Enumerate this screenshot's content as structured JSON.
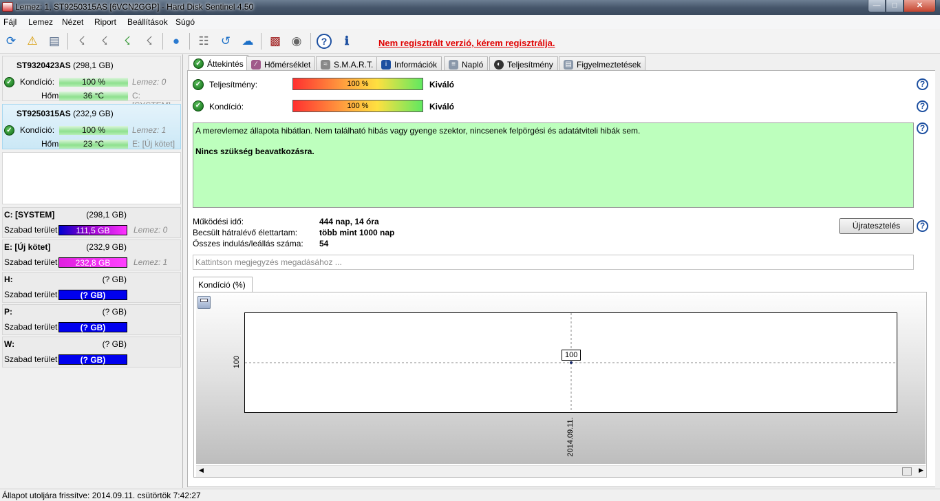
{
  "window": {
    "title": "Lemez: 1, ST9250315AS [6VCN2GGP]  -  Hard Disk Sentinel 4.50"
  },
  "menu": [
    "Fájl",
    "Lemez",
    "Nézet",
    "Riport",
    "Beállítások",
    "Súgó"
  ],
  "toolbar": {
    "icons": [
      "refresh-icon",
      "alert-icon",
      "disk-icon",
      "usb-icon-1",
      "usb-icon-2",
      "usb-icon-3",
      "usb-icon-4",
      "globe-icon",
      "report-icon",
      "sync-icon",
      "network-icon",
      "chart-icon",
      "sound-icon",
      "help-icon",
      "info-icon"
    ],
    "notice": "Nem regisztrált verzió, kérem regisztrálja."
  },
  "disks": [
    {
      "model": "ST9320423AS",
      "size": "(298,1 GB)",
      "health_label": "Kondíció:",
      "health": "100 %",
      "temp_label": "Hőm.:",
      "temp": "36 °C",
      "disk_ref": "Lemez: 0",
      "volume": "C: [SYSTEM]"
    },
    {
      "model": "ST9250315AS",
      "size": "(232,9 GB)",
      "health_label": "Kondíció:",
      "health": "100 %",
      "temp_label": "Hőm.:",
      "temp": "23 °C",
      "disk_ref": "Lemez: 1",
      "volume": "E: [Új kötet]"
    }
  ],
  "volumes": [
    {
      "name": "C: [SYSTEM]",
      "size": "(298,1 GB)",
      "free_label": "Szabad terület",
      "free": "111,5 GB",
      "disk_ref": "Lemez: 0"
    },
    {
      "name": "E: [Új kötet]",
      "size": "(232,9 GB)",
      "free_label": "Szabad terület",
      "free": "232,8 GB",
      "disk_ref": "Lemez: 1"
    },
    {
      "name": "H:",
      "size": "(? GB)",
      "free_label": "Szabad terület",
      "free": "(? GB)",
      "disk_ref": ""
    },
    {
      "name": "P:",
      "size": "(? GB)",
      "free_label": "Szabad terület",
      "free": "(? GB)",
      "disk_ref": ""
    },
    {
      "name": "W:",
      "size": "(? GB)",
      "free_label": "Szabad terület",
      "free": "(? GB)",
      "disk_ref": ""
    }
  ],
  "tabs": [
    "Áttekintés",
    "Hőmérséklet",
    "S.M.A.R.T.",
    "Információk",
    "Napló",
    "Teljesítmény",
    "Figyelmeztetések"
  ],
  "overview": {
    "performance_label": "Teljesítmény:",
    "performance_value": "100 %",
    "performance_text": "Kiváló",
    "health_label": "Kondíció:",
    "health_value": "100 %",
    "health_text": "Kiváló",
    "status_text": "A merevlemez állapota hibátlan. Nem található hibás vagy gyenge szektor, nincsenek felpörgési és adatátviteli hibák sem.",
    "advice": "Nincs szükség beavatkozásra.",
    "uptime_label": "Működési idő:",
    "uptime": "444 nap, 14 óra",
    "remaining_label": "Becsült hátralévő élettartam:",
    "remaining": "több mint 1000 nap",
    "startstop_label": "Összes indulás/leállás száma:",
    "startstop": "54",
    "retest_button": "Újratesztelés",
    "note_placeholder": "Kattintson megjegyzés megadásához ..."
  },
  "chart_tab": "Kondíció  (%)",
  "chart_data": {
    "type": "line",
    "title": "",
    "x": [
      "2014.09.11."
    ],
    "y": [
      100
    ],
    "y_tick_label": "100",
    "point_label": "100",
    "x_tick_label": "2014.09.11."
  },
  "statusbar": {
    "text": "Állapot utoljára frissítve: 2014.09.11. csütörtök 7:42:27"
  }
}
